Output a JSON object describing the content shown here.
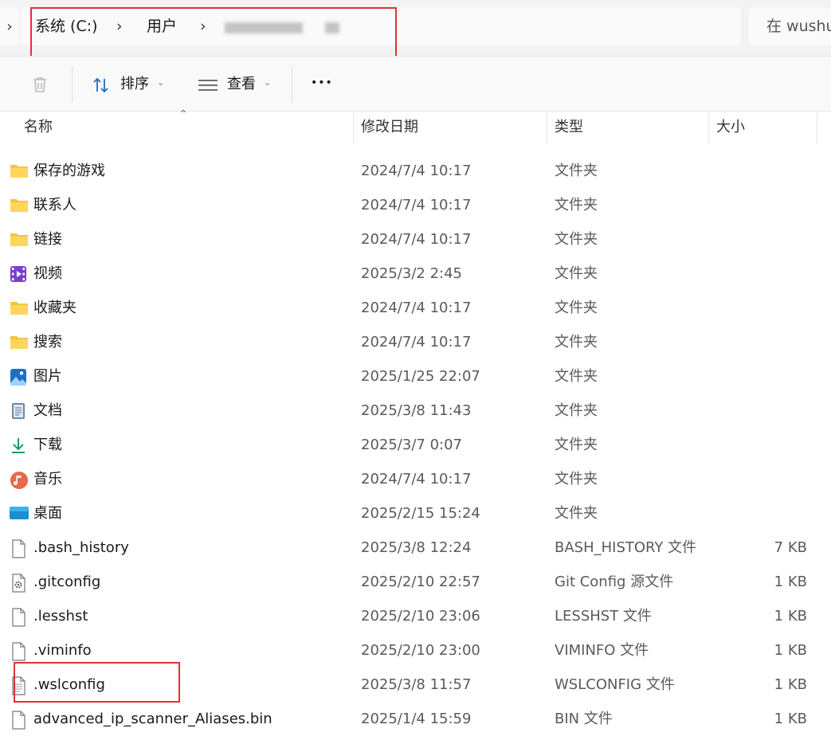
{
  "address_bar": {
    "expand_glyph": "›",
    "crumbs": [
      "系统 (C:)",
      "用户"
    ],
    "separator": "›",
    "search_placeholder": "在 wushu"
  },
  "toolbar": {
    "sort_label": "排序",
    "view_label": "查看",
    "more_label": "•••"
  },
  "columns": {
    "name": "名称",
    "date": "修改日期",
    "type": "类型",
    "size": "大小"
  },
  "rows": [
    {
      "name": "保存的游戏",
      "date": "2024/7/4 10:17",
      "type": "文件夹",
      "size": "",
      "icon": "folder-icon"
    },
    {
      "name": "联系人",
      "date": "2024/7/4 10:17",
      "type": "文件夹",
      "size": "",
      "icon": "folder-icon"
    },
    {
      "name": "链接",
      "date": "2024/7/4 10:17",
      "type": "文件夹",
      "size": "",
      "icon": "folder-icon"
    },
    {
      "name": "视频",
      "date": "2025/3/2 2:45",
      "type": "文件夹",
      "size": "",
      "icon": "video-folder-icon"
    },
    {
      "name": "收藏夹",
      "date": "2024/7/4 10:17",
      "type": "文件夹",
      "size": "",
      "icon": "folder-icon"
    },
    {
      "name": "搜索",
      "date": "2024/7/4 10:17",
      "type": "文件夹",
      "size": "",
      "icon": "folder-icon"
    },
    {
      "name": "图片",
      "date": "2025/1/25 22:07",
      "type": "文件夹",
      "size": "",
      "icon": "pictures-folder-icon"
    },
    {
      "name": "文档",
      "date": "2025/3/8 11:43",
      "type": "文件夹",
      "size": "",
      "icon": "documents-folder-icon"
    },
    {
      "name": "下载",
      "date": "2025/3/7 0:07",
      "type": "文件夹",
      "size": "",
      "icon": "downloads-folder-icon"
    },
    {
      "name": "音乐",
      "date": "2024/7/4 10:17",
      "type": "文件夹",
      "size": "",
      "icon": "music-folder-icon"
    },
    {
      "name": "桌面",
      "date": "2025/2/15 15:24",
      "type": "文件夹",
      "size": "",
      "icon": "desktop-folder-icon"
    },
    {
      "name": ".bash_history",
      "date": "2025/3/8 12:24",
      "type": "BASH_HISTORY 文件",
      "size": "7 KB",
      "icon": "file-icon"
    },
    {
      "name": ".gitconfig",
      "date": "2025/2/10 22:57",
      "type": "Git Config 源文件",
      "size": "1 KB",
      "icon": "config-file-icon"
    },
    {
      "name": ".lesshst",
      "date": "2025/2/10 23:06",
      "type": "LESSHST 文件",
      "size": "1 KB",
      "icon": "file-icon"
    },
    {
      "name": ".viminfo",
      "date": "2025/2/10 23:00",
      "type": "VIMINFO 文件",
      "size": "1 KB",
      "icon": "file-icon"
    },
    {
      "name": ".wslconfig",
      "date": "2025/3/8 11:57",
      "type": "WSLCONFIG 文件",
      "size": "1 KB",
      "icon": "text-file-icon"
    },
    {
      "name": "advanced_ip_scanner_Aliases.bin",
      "date": "2025/1/4 15:59",
      "type": "BIN 文件",
      "size": "1 KB",
      "icon": "file-icon"
    }
  ],
  "colors": {
    "highlight_box": "#e0303a",
    "folder_yellow": "#f5c542"
  }
}
